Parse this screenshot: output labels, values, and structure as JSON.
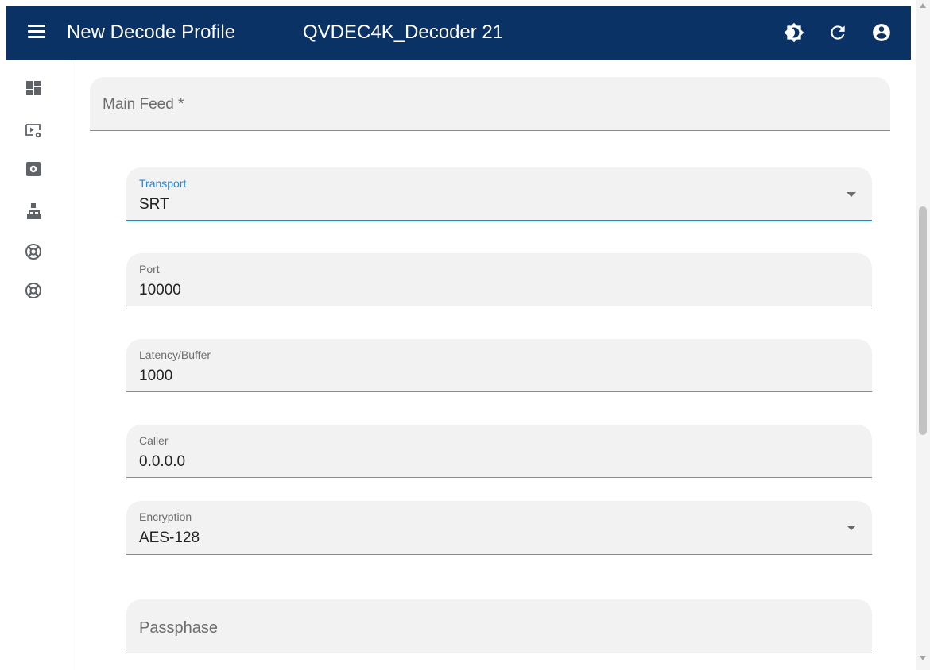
{
  "header": {
    "app_title": "New Decode Profile",
    "device_name": "QVDEC4K_Decoder 21",
    "icons": [
      "menu-icon",
      "theme-toggle-icon",
      "refresh-icon",
      "account-icon"
    ]
  },
  "sidebar": {
    "icons": [
      "dashboard-icon",
      "video-settings-icon",
      "settings-icon",
      "network-icon",
      "support-icon",
      "support-icon"
    ]
  },
  "form": {
    "main_feed": {
      "placeholder": "Main Feed *"
    },
    "transport": {
      "label": "Transport",
      "value": "SRT"
    },
    "port": {
      "label": "Port",
      "value": "10000"
    },
    "latency": {
      "label": "Latency/Buffer",
      "value": "1000"
    },
    "caller": {
      "label": "Caller",
      "value": "0.0.0.0"
    },
    "encryption": {
      "label": "Encryption",
      "value": "AES-128"
    },
    "passphrase": {
      "placeholder": "Passphase"
    }
  },
  "colors": {
    "header_bg": "#0b3265",
    "field_bg": "#f2f2f2",
    "focus_accent": "#1e88e5"
  }
}
